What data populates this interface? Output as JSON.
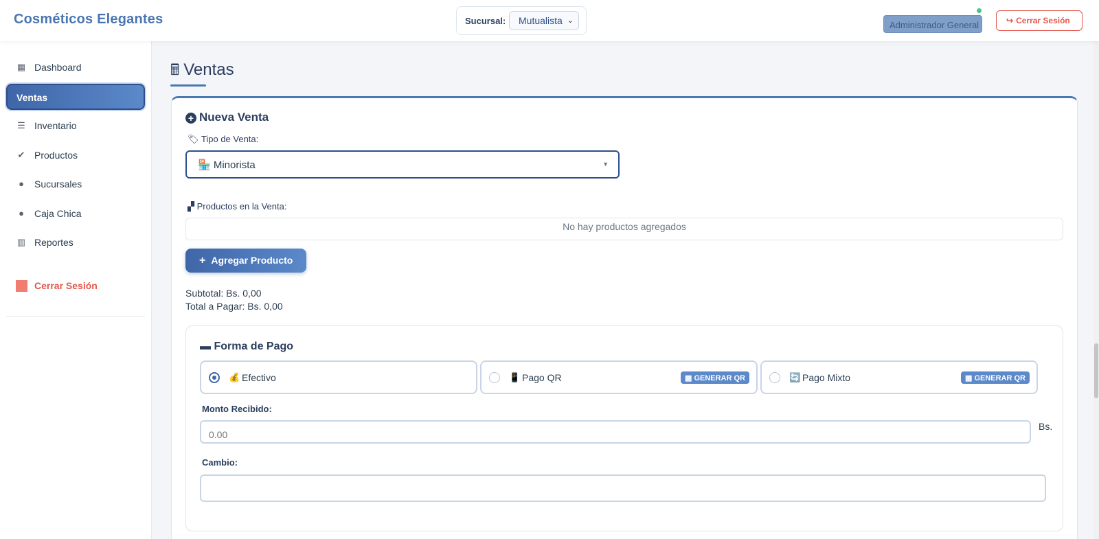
{
  "app": {
    "brand": "Cosméticos Elegantes"
  },
  "header": {
    "branch_label": "Sucursal:",
    "branch_value": "Mutualista",
    "user_role": "Administrador General",
    "logout_label": "Cerrar Sesión"
  },
  "sidebar": {
    "items": [
      {
        "label": "Dashboard",
        "icon": "dashboard-icon"
      },
      {
        "label": "Ventas",
        "icon": "",
        "active": true
      },
      {
        "label": "Inventario",
        "icon": "store-icon"
      },
      {
        "label": "Productos",
        "icon": "check-circle-icon"
      },
      {
        "label": "Sucursales",
        "icon": "map-pin-icon"
      },
      {
        "label": "Caja Chica",
        "icon": "circle-icon"
      },
      {
        "label": "Reportes",
        "icon": "chart-icon"
      }
    ],
    "logout_label": "Cerrar Sesión"
  },
  "main": {
    "page_title": "Ventas",
    "card_title": "Nueva Venta",
    "sale_type_label": "Tipo de Venta:",
    "sale_type_value": "Minorista",
    "products_label": "Productos en la Venta:",
    "products_empty": "No hay productos agregados",
    "add_product_label": "Agregar Producto",
    "subtotal": "Subtotal: Bs. 0,00",
    "total": "Total a Pagar: Bs. 0,00",
    "payment": {
      "title": "Forma de Pago",
      "options": [
        {
          "label": "Efectivo",
          "emoji": "💰",
          "selected": true
        },
        {
          "label": "Pago QR",
          "emoji": "📱",
          "qr_label": "GENERAR QR"
        },
        {
          "label": "Pago Mixto",
          "emoji": "🔄",
          "qr_label": "GENERAR QR"
        }
      ],
      "amount_label": "Monto Recibido:",
      "amount_placeholder": "0.00",
      "currency_suffix": "Bs.",
      "change_label": "Cambio:",
      "change_value": ""
    }
  },
  "colors": {
    "accent": "#4a76b2",
    "danger": "#e2574c",
    "dark": "#2c3e60"
  }
}
